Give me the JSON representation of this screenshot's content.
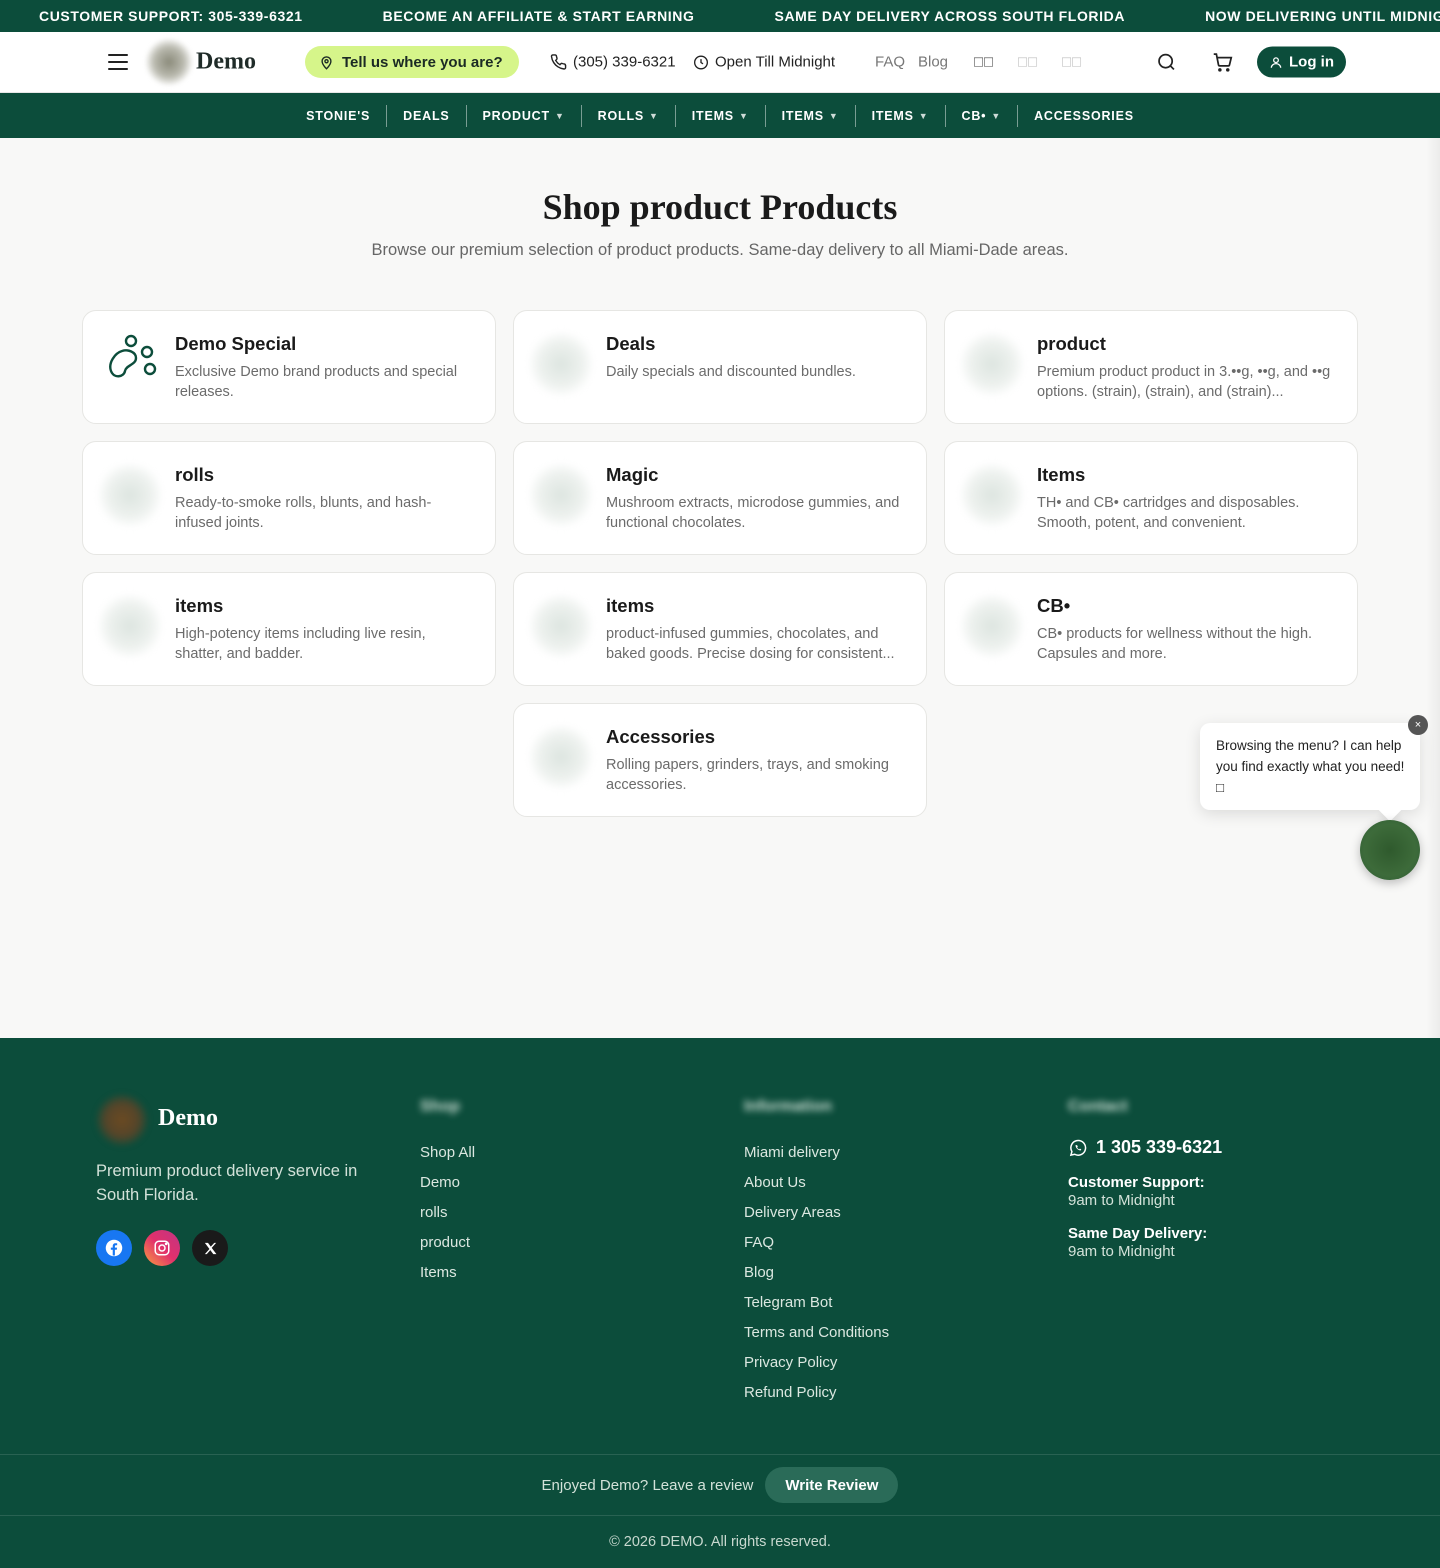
{
  "announcements": [
    "CUSTOMER SUPPORT: 305-339-6321",
    "BECOME AN AFFILIATE & START EARNING",
    "SAME DAY DELIVERY ACROSS SOUTH FLORIDA",
    "NOW DELIVERING UNTIL MIDNIGHT"
  ],
  "header": {
    "logo_text": "Demo",
    "location_label": "Tell us where you are?",
    "phone": "(305) 339-6321",
    "hours": "Open Till Midnight",
    "faq": "FAQ",
    "blog": "Blog",
    "languages": [
      "□□",
      "□□",
      "□□"
    ],
    "login": "Log in"
  },
  "nav": [
    {
      "label": "STONIE'S",
      "dropdown": false
    },
    {
      "label": "DEALS",
      "dropdown": false
    },
    {
      "label": "PRODUCT",
      "dropdown": true
    },
    {
      "label": "ROLLS",
      "dropdown": true
    },
    {
      "label": "ITEMS",
      "dropdown": true
    },
    {
      "label": "ITEMS",
      "dropdown": true
    },
    {
      "label": "ITEMS",
      "dropdown": true
    },
    {
      "label": "CB•",
      "dropdown": true
    },
    {
      "label": "ACCESSORIES",
      "dropdown": false
    }
  ],
  "main": {
    "title": "Shop product Products",
    "subtitle": "Browse our premium selection of product products. Same-day delivery to all Miami-Dade areas."
  },
  "categories": [
    {
      "title": "Demo Special",
      "desc": "Exclusive Demo brand products and special releases."
    },
    {
      "title": "Deals",
      "desc": "Daily specials and discounted bundles."
    },
    {
      "title": "product",
      "desc": "Premium product product in 3.••g, ••g, and ••g options. (strain), (strain), and (strain)..."
    },
    {
      "title": "rolls",
      "desc": "Ready-to-smoke rolls, blunts, and hash-infused joints."
    },
    {
      "title": "Magic",
      "desc": "Mushroom extracts, microdose gummies, and functional chocolates."
    },
    {
      "title": "Items",
      "desc": "TH• and CB• cartridges and disposables. Smooth, potent, and convenient."
    },
    {
      "title": "items",
      "desc": "High-potency items including live resin, shatter, and badder."
    },
    {
      "title": "items",
      "desc": "product-infused gummies, chocolates, and baked goods. Precise dosing for consistent..."
    },
    {
      "title": "CB•",
      "desc": "CB• products for wellness without the high. Capsules and more."
    },
    {
      "title": "Accessories",
      "desc": "Rolling papers, grinders, trays, and smoking accessories."
    }
  ],
  "chat": {
    "message": "Browsing the menu? I can help you find exactly what you need! □",
    "close": "×"
  },
  "footer": {
    "logo_text": "Demo",
    "tagline": "Premium product delivery service in South Florida.",
    "shop_heading": "Shop",
    "shop_links": [
      "Shop All",
      "Demo",
      "rolls",
      "product",
      "Items"
    ],
    "info_heading": "Information",
    "info_links": [
      "Miami delivery",
      "About Us",
      "Delivery Areas",
      "FAQ",
      "Blog",
      "Telegram Bot",
      "Terms and Conditions",
      "Privacy Policy",
      "Refund Policy"
    ],
    "contact_heading": "Contact",
    "phone": "1 305 339-6321",
    "support_label": "Customer Support:",
    "support_value": "9am to Midnight",
    "delivery_label": "Same Day Delivery:",
    "delivery_value": "9am to Midnight",
    "review_text": "Enjoyed Demo? Leave a review",
    "review_button": "Write Review",
    "copyright": "© 2026 DEMO. All rights reserved."
  },
  "colors": {
    "brand_green": "#0c4d3b",
    "accent_lime": "#d6f58a",
    "background": "#f8f8f7"
  }
}
